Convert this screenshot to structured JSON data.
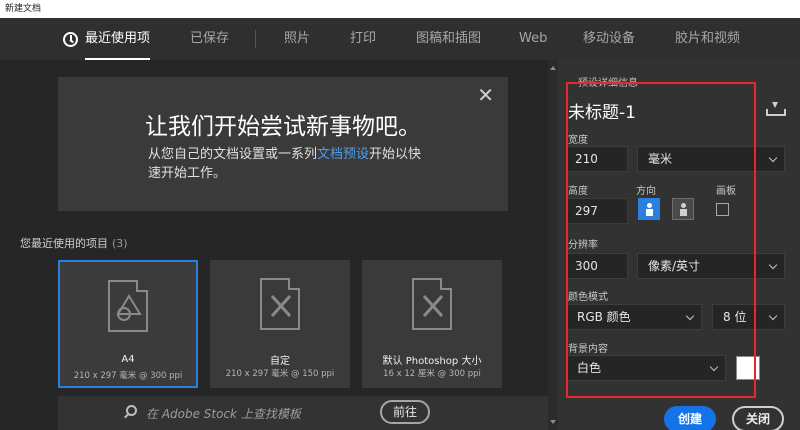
{
  "window": {
    "title": "新建文档"
  },
  "tabs": [
    {
      "label": "最近使用项",
      "active": true
    },
    {
      "label": "已保存"
    },
    {
      "label": "照片"
    },
    {
      "label": "打印"
    },
    {
      "label": "图稿和插图"
    },
    {
      "label": "Web"
    },
    {
      "label": "移动设备"
    },
    {
      "label": "胶片和视频"
    }
  ],
  "hero": {
    "title": "让我们开始尝试新事物吧。",
    "text_before": "从您自己的文档设置或一系列",
    "link": "文档预设",
    "text_after": "开始以快速开始工作。"
  },
  "recent": {
    "label": "您最近使用的项目",
    "count": "(3)",
    "items": [
      {
        "name": "A4",
        "size": "210 x 297 毫米 @ 300 ppi",
        "selected": true
      },
      {
        "name": "自定",
        "size": "210 x 297 毫米 @ 150 ppi"
      },
      {
        "name": "默认 Photoshop 大小",
        "size": "16 x 12 厘米 @ 300 ppi"
      }
    ]
  },
  "stock": {
    "placeholder": "在 Adobe Stock 上查找模板",
    "go_label": "前往"
  },
  "details": {
    "header": "预设详细信息",
    "doc_title": "未标题-1",
    "width_label": "宽度",
    "width_value": "210",
    "width_unit": "毫米",
    "height_label": "高度",
    "height_value": "297",
    "orientation_label": "方向",
    "artboard_label": "画板",
    "resolution_label": "分辨率",
    "resolution_value": "300",
    "resolution_unit": "像素/英寸",
    "color_mode_label": "颜色模式",
    "color_mode_value": "RGB 颜色",
    "bit_depth_value": "8 位",
    "background_label": "背景内容",
    "background_value": "白色",
    "background_color": "#ffffff"
  },
  "buttons": {
    "create": "创建",
    "close": "关闭"
  },
  "colors": {
    "accent": "#1473e6",
    "highlight_border": "#e8262b",
    "link": "#4f9cf0"
  }
}
